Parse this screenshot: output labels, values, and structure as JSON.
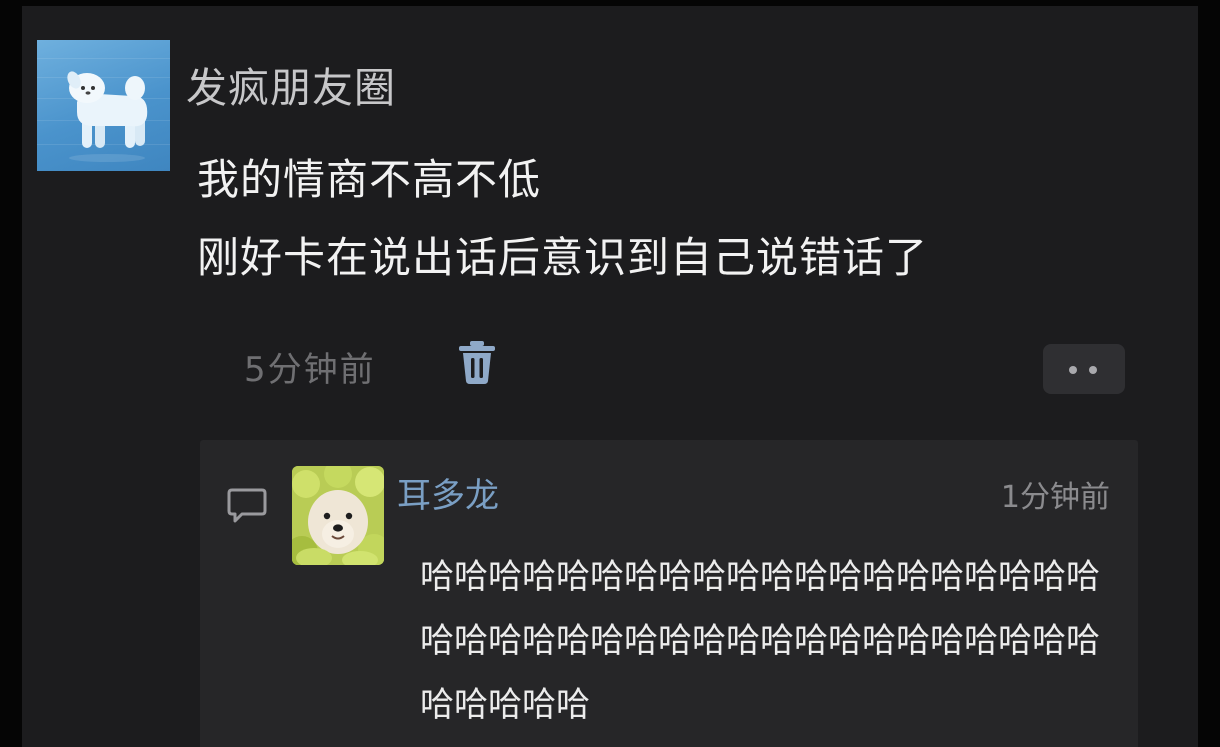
{
  "post": {
    "username": "发疯朋友圈",
    "avatar_icon": "white-dog-avatar-icon",
    "lines": [
      "我的情商不高不低",
      "刚好卡在说出话后意识到自己说错话了"
    ],
    "time": "5分钟前",
    "delete_icon": "trash-icon",
    "more_icon": "more-dots-icon"
  },
  "comment": {
    "icon": "comment-bubble-icon",
    "avatar_icon": "dog-in-lettuce-avatar-icon",
    "author": "耳多龙",
    "time": "1分钟前",
    "text": "哈哈哈哈哈哈哈哈哈哈哈哈哈哈哈哈哈哈哈哈哈哈哈哈哈哈哈哈哈哈哈哈哈哈哈哈哈哈哈哈哈哈哈哈哈"
  },
  "colors": {
    "background": "#1c1c1e",
    "comment_panel": "#262628",
    "author_link": "#7a9fc4",
    "muted_text": "#6f6f72"
  }
}
